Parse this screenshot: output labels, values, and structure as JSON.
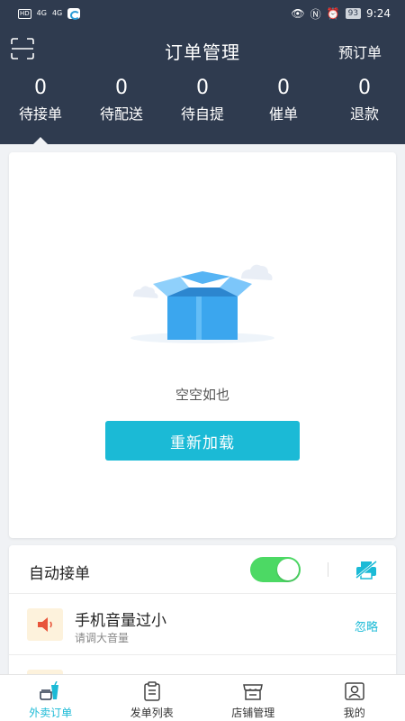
{
  "status_bar": {
    "chip": "HD",
    "sig1": "4G",
    "sig2": "4G",
    "battery": "93",
    "time": "9:24"
  },
  "header": {
    "title": "订单管理",
    "preorder_label": "预订单",
    "stats": [
      {
        "count": "0",
        "label": "待接单"
      },
      {
        "count": "0",
        "label": "待配送"
      },
      {
        "count": "0",
        "label": "待自提"
      },
      {
        "count": "0",
        "label": "催单"
      },
      {
        "count": "0",
        "label": "退款"
      }
    ],
    "active_stat": "待接单"
  },
  "empty_state": {
    "message": "空空如也",
    "reload_label": "重新加载"
  },
  "settings": {
    "auto_accept_label": "自动接单",
    "auto_accept_on": true,
    "alerts": [
      {
        "title": "手机音量过小",
        "subtitle": "请调大音量",
        "action": "忽略"
      }
    ]
  },
  "bottom_nav": {
    "items": [
      {
        "label": "外卖订单",
        "icon": "takeout-cup-icon",
        "active": true
      },
      {
        "label": "发单列表",
        "icon": "clipboard-list-icon",
        "active": false
      },
      {
        "label": "店铺管理",
        "icon": "store-icon",
        "active": false
      },
      {
        "label": "我的",
        "icon": "profile-icon",
        "active": false
      }
    ]
  },
  "colors": {
    "header_bg": "#2f3b4f",
    "accent": "#1bbad6",
    "toggle_on": "#4cd964"
  }
}
